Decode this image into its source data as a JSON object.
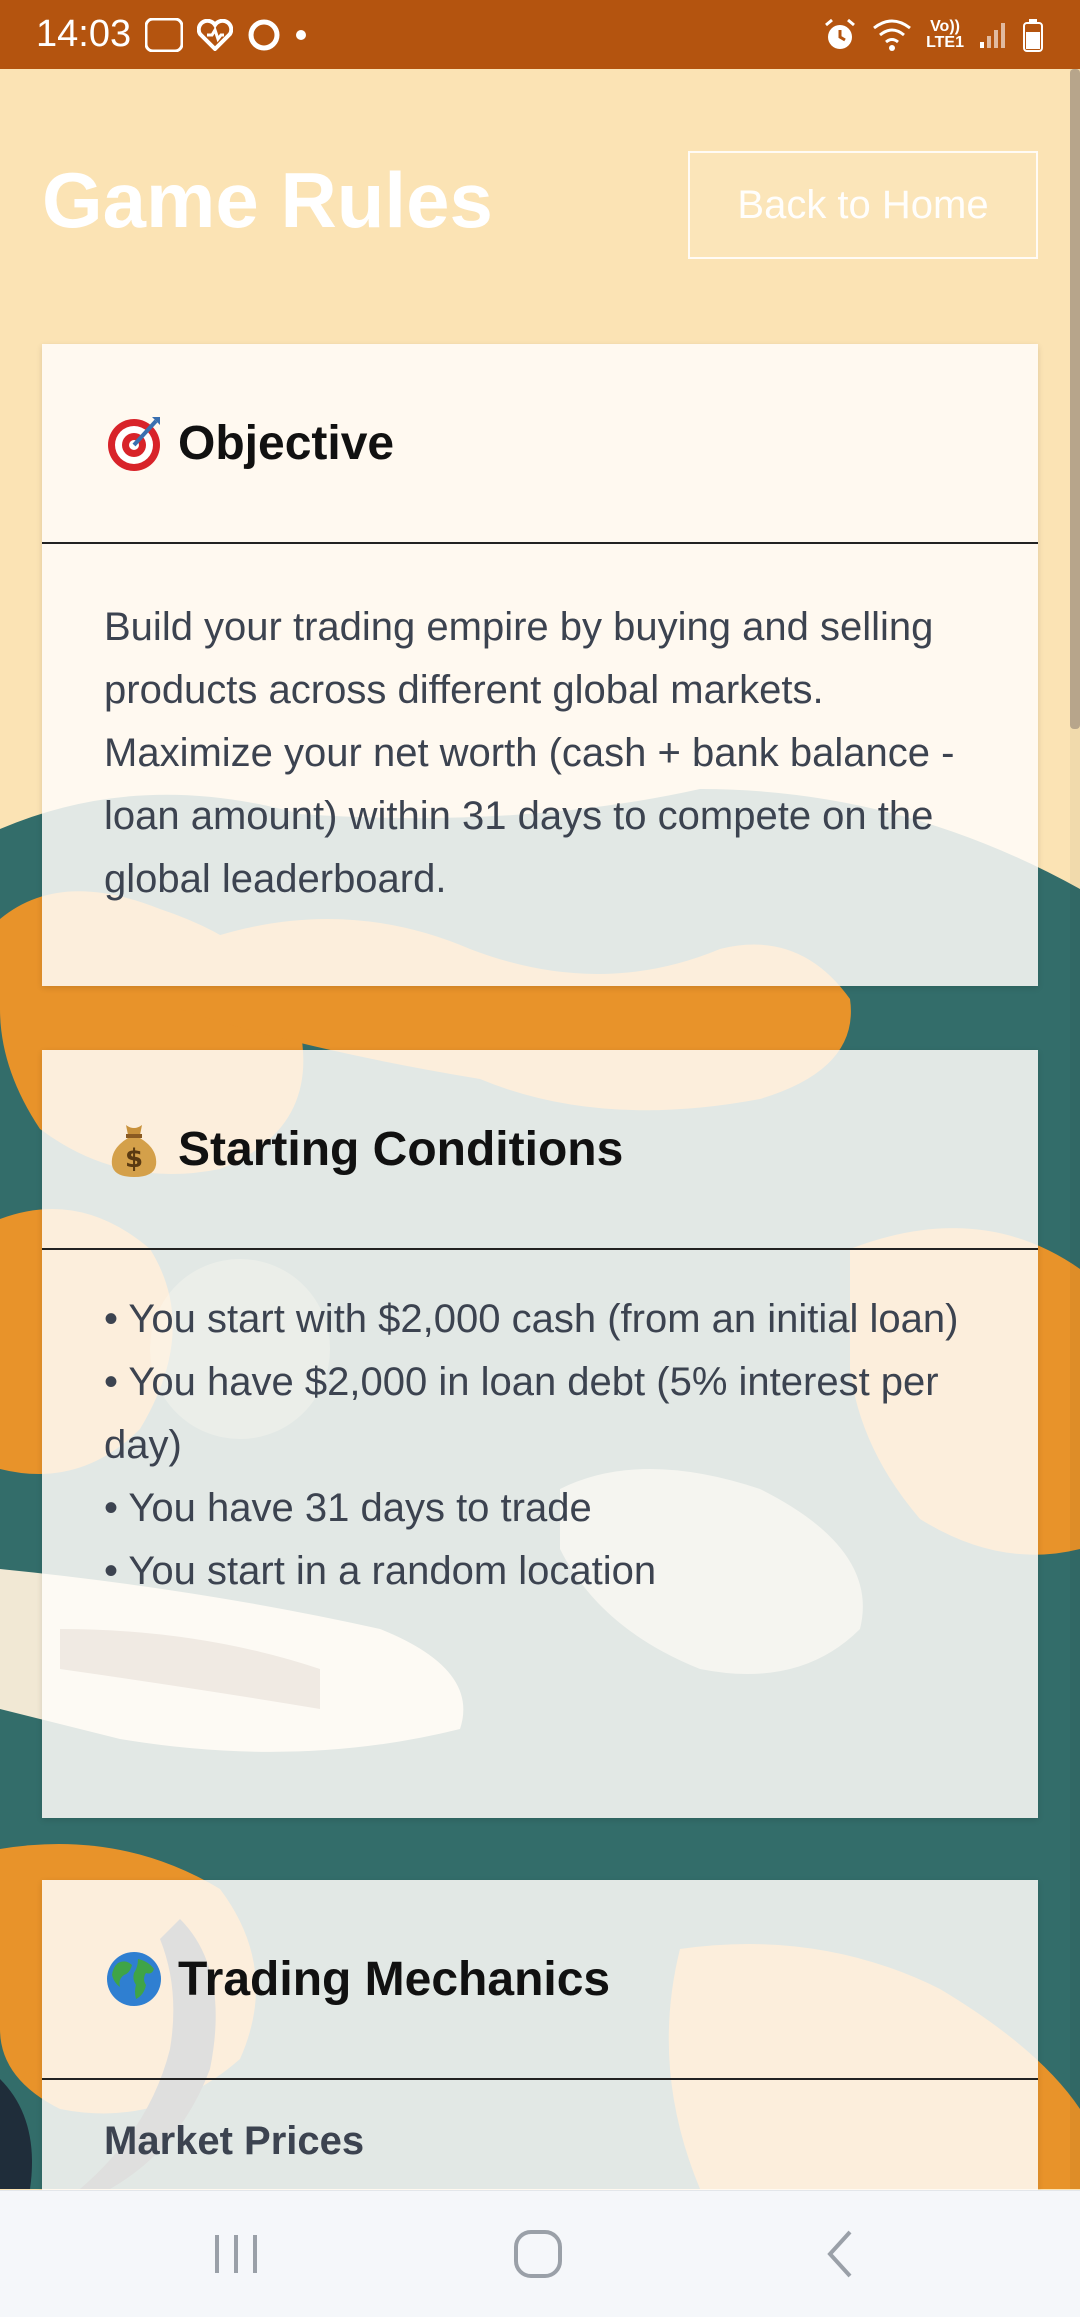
{
  "status_bar": {
    "time": "14:03",
    "left_icons": [
      "ring-icon",
      "heart-app-icon",
      "circle-app-icon",
      "dot-indicator"
    ],
    "ring_label": "ring",
    "volte_label_top": "Vo))",
    "volte_label_bottom": "LTE1",
    "right_icons": [
      "alarm-icon",
      "wifi-icon",
      "volte-icon",
      "signal-icon",
      "battery-icon"
    ]
  },
  "header": {
    "title": "Game Rules",
    "back_button_label": "Back to Home"
  },
  "cards": {
    "objective": {
      "icon": "target-icon",
      "title": "Objective",
      "body": "Build your trading empire by buying and selling products across different global markets. Maximize your net worth (cash + bank balance - loan amount) within 31 days to compete on the global leaderboard."
    },
    "starting": {
      "icon": "money-bag-icon",
      "title": "Starting Conditions",
      "items": [
        "• You start with $2,000 cash (from an initial loan)",
        "• You have $2,000 in loan debt (5% interest per day)",
        "• You have 31 days to trade",
        "• You start in a random location"
      ]
    },
    "trading": {
      "icon": "globe-icon",
      "title": "Trading Mechanics",
      "subheading": "Market Prices"
    }
  },
  "navbar": {
    "buttons": [
      "recent-apps-button",
      "home-button",
      "back-button"
    ]
  },
  "colors": {
    "status_bar": "#b4540f",
    "page_bg": "#fbe3b4",
    "card_bg": "#fffdf9",
    "body_text": "#3c4350",
    "map_ocean": "#336d6a",
    "map_land": "#e8932a"
  }
}
